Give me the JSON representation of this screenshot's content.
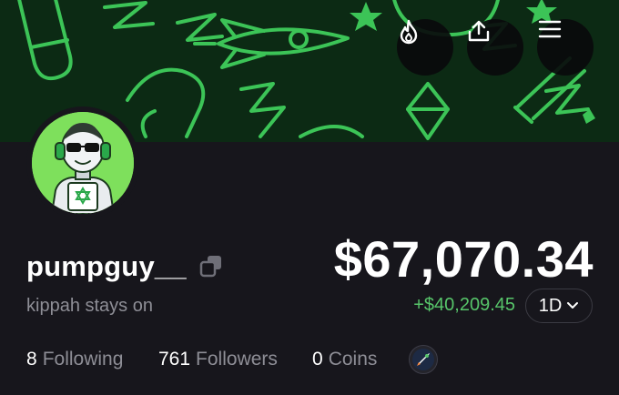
{
  "banner": {
    "bg_color": "#0c2a14",
    "doodle_color": "#3cc457"
  },
  "header_actions": [
    {
      "name": "fire-icon"
    },
    {
      "name": "share-icon"
    },
    {
      "name": "menu-icon"
    }
  ],
  "profile": {
    "username": "pumpguy__",
    "bio": "kippah stays on",
    "avatar_bg": "#7ee05c"
  },
  "portfolio": {
    "balance": "$67,070.34",
    "change": "+$40,209.45",
    "change_color": "#57c56a",
    "timeframe": "1D"
  },
  "stats": {
    "following_count": "8",
    "following_label": "Following",
    "followers_count": "761",
    "followers_label": "Followers",
    "coins_count": "0",
    "coins_label": "Coins"
  }
}
